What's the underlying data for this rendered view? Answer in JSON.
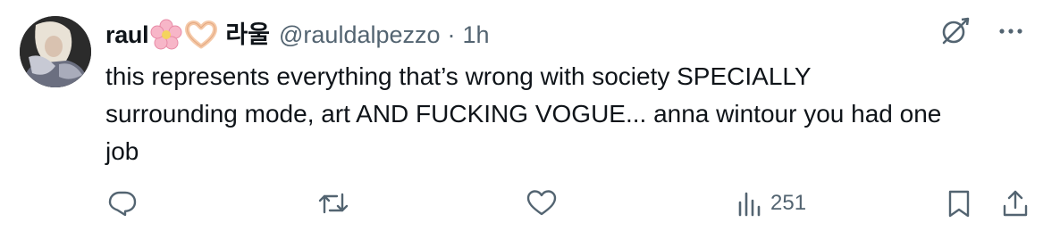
{
  "tweet": {
    "display_name": "raul",
    "display_name_emojis": [
      "cherry-blossom-emoji",
      "heart-hands-emoji"
    ],
    "korean_name": "라울",
    "handle": "@rauldalpezzo",
    "separator": "·",
    "timestamp": "1h",
    "text": "this represents everything that’s wrong with society SPECIALLY\nsurrounding mode, art AND FUCKING VOGUE... anna wintour you had one\njob"
  },
  "actions": {
    "reply_icon": "reply-icon",
    "retweet_icon": "retweet-icon",
    "like_icon": "like-icon",
    "views_icon": "views-icon",
    "views_count": "251",
    "bookmark_icon": "bookmark-icon",
    "share_icon": "share-icon"
  },
  "colors": {
    "text_primary": "#0f1419",
    "text_secondary": "#536471",
    "background": "#ffffff"
  }
}
